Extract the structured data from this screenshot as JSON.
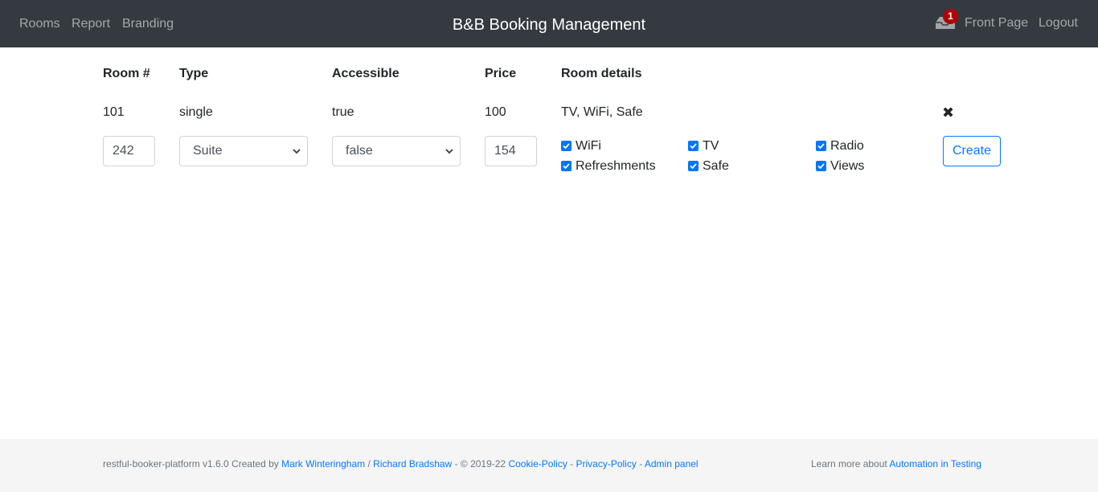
{
  "nav": {
    "links": [
      "Rooms",
      "Report",
      "Branding"
    ],
    "brand": "B&B Booking Management",
    "notification_count": "1",
    "front_page": "Front Page",
    "logout": "Logout"
  },
  "table": {
    "headers": [
      "Room #",
      "Type",
      "Accessible",
      "Price",
      "Room details"
    ],
    "rows": [
      {
        "room": "101",
        "type": "single",
        "accessible": "true",
        "price": "100",
        "details": "TV, WiFi, Safe"
      }
    ]
  },
  "new_room": {
    "room_number": "242",
    "type": "Suite",
    "accessible": "false",
    "price": "154",
    "features": [
      "WiFi",
      "TV",
      "Radio",
      "Refreshments",
      "Safe",
      "Views"
    ],
    "create_label": "Create"
  },
  "footer": {
    "prefix": "restful-booker-platform v1.6.0 Created by",
    "author1": "Mark Winteringham",
    "sep1": "/",
    "author2": "Richard Bradshaw",
    "copyright": "- © 2019-22",
    "cookie": "Cookie-Policy",
    "dash1": "-",
    "privacy": "Privacy-Policy",
    "dash2": "-",
    "admin": "Admin panel",
    "learn_prefix": "Learn more about",
    "learn_link": "Automation in Testing"
  },
  "colors": {
    "navbar": "#343a40",
    "accent": "#007bff",
    "badge": "#b50000",
    "checkbox": "#0075ff"
  }
}
